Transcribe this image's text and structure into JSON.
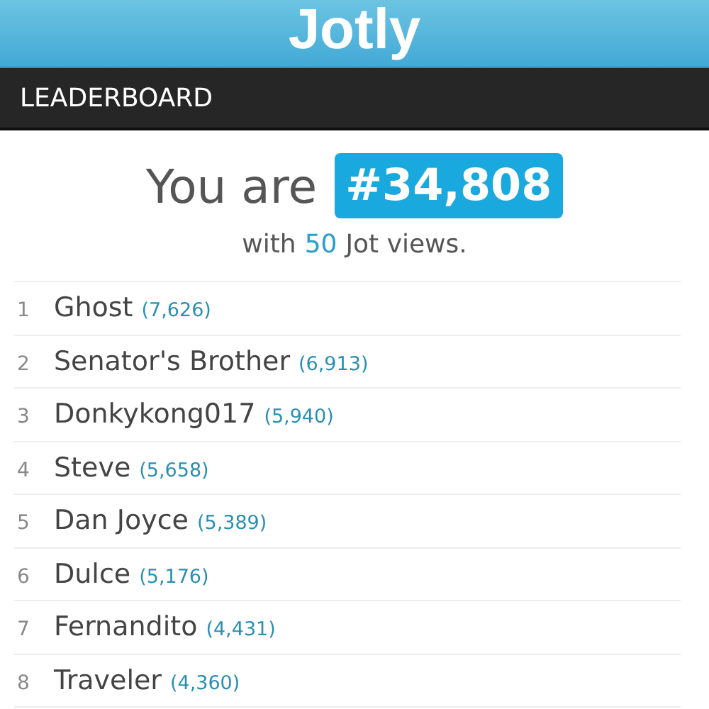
{
  "app": {
    "logo": "Jotly"
  },
  "section_bar": {
    "title": "LEADERBOARD"
  },
  "rank_summary": {
    "label": "You are",
    "rank": "#34,808",
    "prefix": "with",
    "views": "50",
    "suffix": "Jot views."
  },
  "leaderboard": [
    {
      "rank": "1",
      "name": "Ghost",
      "score": "(7,626)"
    },
    {
      "rank": "2",
      "name": "Senator's Brother",
      "score": "(6,913)"
    },
    {
      "rank": "3",
      "name": "Donkykong017",
      "score": "(5,940)"
    },
    {
      "rank": "4",
      "name": "Steve",
      "score": "(5,658)"
    },
    {
      "rank": "5",
      "name": "Dan Joyce",
      "score": "(5,389)"
    },
    {
      "rank": "6",
      "name": "Dulce",
      "score": "(5,176)"
    },
    {
      "rank": "7",
      "name": "Fernandito",
      "score": "(4,431)"
    },
    {
      "rank": "8",
      "name": "Traveler",
      "score": "(4,360)"
    }
  ]
}
